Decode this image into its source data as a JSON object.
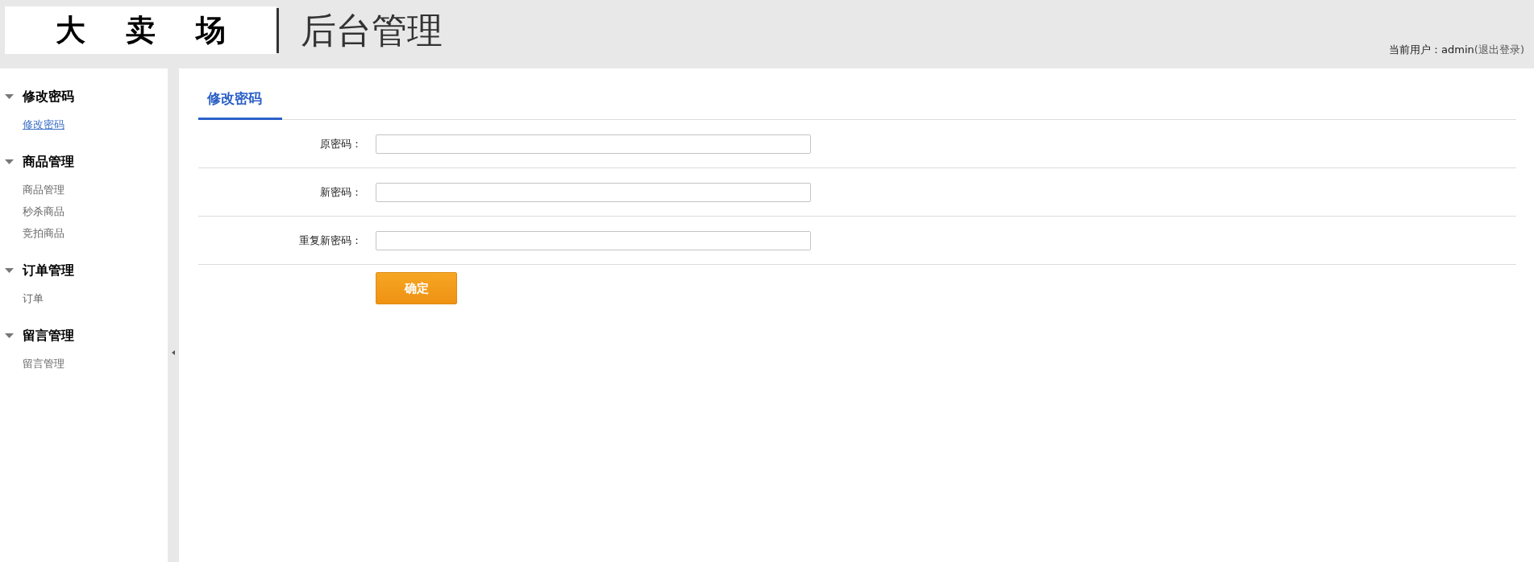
{
  "header": {
    "logo": "大 卖 场",
    "title": "后台管理",
    "user_label": "当前用户：admin",
    "logout_link": "(退出登录)"
  },
  "sidebar": {
    "groups": [
      {
        "title": "修改密码",
        "expanded": true,
        "items": [
          {
            "label": "修改密码",
            "selected": true
          }
        ]
      },
      {
        "title": "商品管理",
        "expanded": true,
        "items": [
          {
            "label": "商品管理",
            "selected": false
          },
          {
            "label": "秒杀商品",
            "selected": false
          },
          {
            "label": "竞拍商品",
            "selected": false
          }
        ]
      },
      {
        "title": "订单管理",
        "expanded": true,
        "items": [
          {
            "label": "订单",
            "selected": false
          }
        ]
      },
      {
        "title": "留言管理",
        "expanded": true,
        "items": [
          {
            "label": "留言管理",
            "selected": false
          }
        ]
      }
    ]
  },
  "tabs": [
    {
      "label": "修改密码",
      "selected": true
    }
  ],
  "form": {
    "fields": [
      {
        "label": "原密码："
      },
      {
        "label": "新密码："
      },
      {
        "label": "重复新密码："
      }
    ],
    "submit": "确定"
  }
}
